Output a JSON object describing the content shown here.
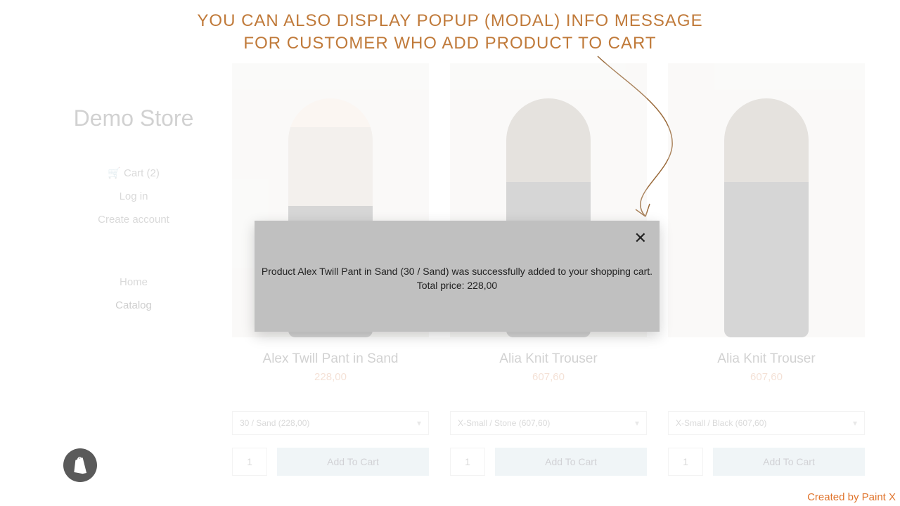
{
  "headline": {
    "line1": "YOU CAN ALSO DISPLAY POPUP (MODAL) INFO MESSAGE",
    "line2": "FOR CUSTOMER WHO ADD PRODUCT TO CART"
  },
  "store": {
    "title": "Demo Store",
    "cart_link": "Cart (2)",
    "login_link": "Log in",
    "create_link": "Create account",
    "nav_home": "Home",
    "nav_catalog": "Catalog"
  },
  "products": [
    {
      "name": "Alex Twill Pant in Sand",
      "price": "228,00",
      "variant": "30 / Sand (228,00)",
      "qty": "1",
      "add_label": "Add To Cart"
    },
    {
      "name": "Alia Knit Trouser",
      "price": "607,60",
      "variant": "X-Small / Stone (607,60)",
      "qty": "1",
      "add_label": "Add To Cart"
    },
    {
      "name": "Alia Knit Trouser",
      "price": "607,60",
      "variant": "X-Small / Black (607,60)",
      "qty": "1",
      "add_label": "Add To Cart"
    }
  ],
  "modal": {
    "message": "Product Alex Twill Pant in Sand (30 / Sand) was successfully added to your shopping cart.",
    "total": "Total price: 228,00"
  },
  "footer": {
    "credit": "Created by Paint X"
  },
  "colors": {
    "accent": "#c07a3a",
    "price": "#d07a4a",
    "button": "#bcd6de",
    "modal_bg": "#c0c0c0"
  }
}
